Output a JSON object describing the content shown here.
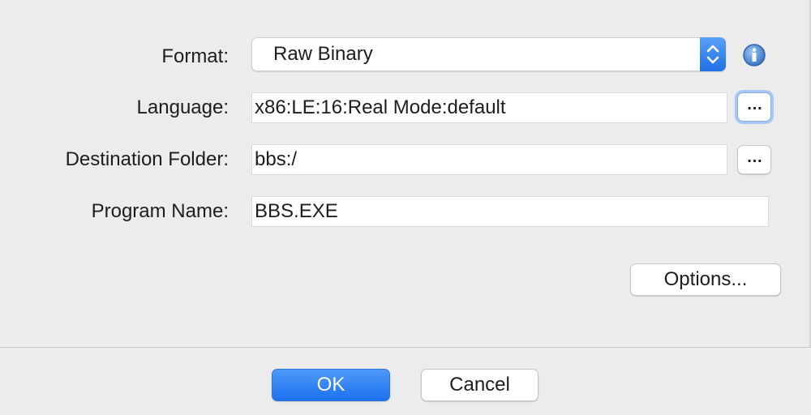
{
  "form": {
    "format_label": "Format:",
    "format_value": "Raw Binary",
    "language_label": "Language:",
    "language_value": "x86:LE:16:Real Mode:default",
    "destination_label": "Destination Folder:",
    "destination_value": "bbs:/",
    "program_label": "Program Name:",
    "program_value": "BBS.EXE",
    "browse_label": "…",
    "options_label": "Options..."
  },
  "footer": {
    "ok_label": "OK",
    "cancel_label": "Cancel"
  },
  "icons": {
    "format_info": "info-icon",
    "format_stepper": "up-down-arrows-icon"
  },
  "colors": {
    "accent": "#2a7bf2",
    "info_icon": "#4a8bd6"
  }
}
